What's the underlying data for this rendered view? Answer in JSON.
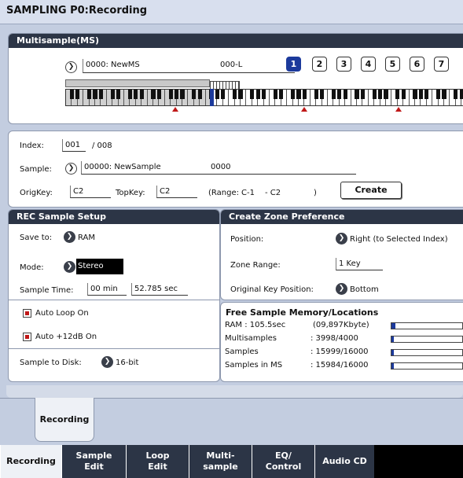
{
  "title": "SAMPLING P0:Recording",
  "multisample": {
    "header": "Multisample(MS)",
    "name": "0000: NewMS",
    "suffix": "000-L",
    "buttons": [
      "1",
      "2",
      "3",
      "4",
      "5",
      "6",
      "7"
    ]
  },
  "index": {
    "label": "Index:",
    "value": "001",
    "total": "/ 008"
  },
  "sample": {
    "label": "Sample:",
    "name": "00000: NewSample",
    "suffix": "0000"
  },
  "keys": {
    "orig_label": "OrigKey:",
    "orig_value": "C2",
    "top_label": "TopKey:",
    "top_value": "C2",
    "range_label": "(Range:",
    "range_low": "C-1",
    "range_dash": "- C2",
    "range_close": ")",
    "create": "Create"
  },
  "rec": {
    "header": "REC Sample Setup",
    "save_label": "Save to:",
    "save_value": "RAM",
    "mode_label": "Mode:",
    "mode_value": "Stereo",
    "time_label": "Sample Time:",
    "time_min": "00 min",
    "time_sec": "52.785 sec",
    "autoloop": "Auto Loop On",
    "auto12": "Auto +12dB On",
    "disk_label": "Sample to Disk:",
    "disk_value": "16-bit"
  },
  "zone": {
    "header": "Create Zone Preference",
    "position_label": "Position:",
    "position_value": "Right (to Selected Index)",
    "range_label": "Zone Range:",
    "range_value": "1 Key",
    "orig_label": "Original Key Position:",
    "orig_value": "Bottom"
  },
  "memory": {
    "header": "Free Sample Memory/Locations",
    "rows": [
      {
        "label": "RAM :  105.5sec",
        "value": "(09,897Kbyte)",
        "level": 0.05
      },
      {
        "label": "Multisamples",
        "value": ": 3998/4000",
        "level": 0.01
      },
      {
        "label": "Samples",
        "value": ": 15999/16000",
        "level": 0.01
      },
      {
        "label": "Samples in MS",
        "value": ": 15984/16000",
        "level": 0.01
      }
    ]
  },
  "page_tab": "Recording",
  "tabs": [
    {
      "line1": "Recording",
      "line2": ""
    },
    {
      "line1": "Sample",
      "line2": "Edit"
    },
    {
      "line1": "Loop",
      "line2": "Edit"
    },
    {
      "line1": "Multi-",
      "line2": "sample"
    },
    {
      "line1": "EQ/",
      "line2": "Control"
    },
    {
      "line1": "Audio CD",
      "line2": ""
    }
  ],
  "colors": {
    "accent": "#1c3a9c",
    "header": "#2c3546",
    "background": "#c3cde0",
    "check": "#c01818"
  },
  "icons": [
    "arrow-right-icon",
    "checkbox-icon",
    "keyboard-icon"
  ]
}
